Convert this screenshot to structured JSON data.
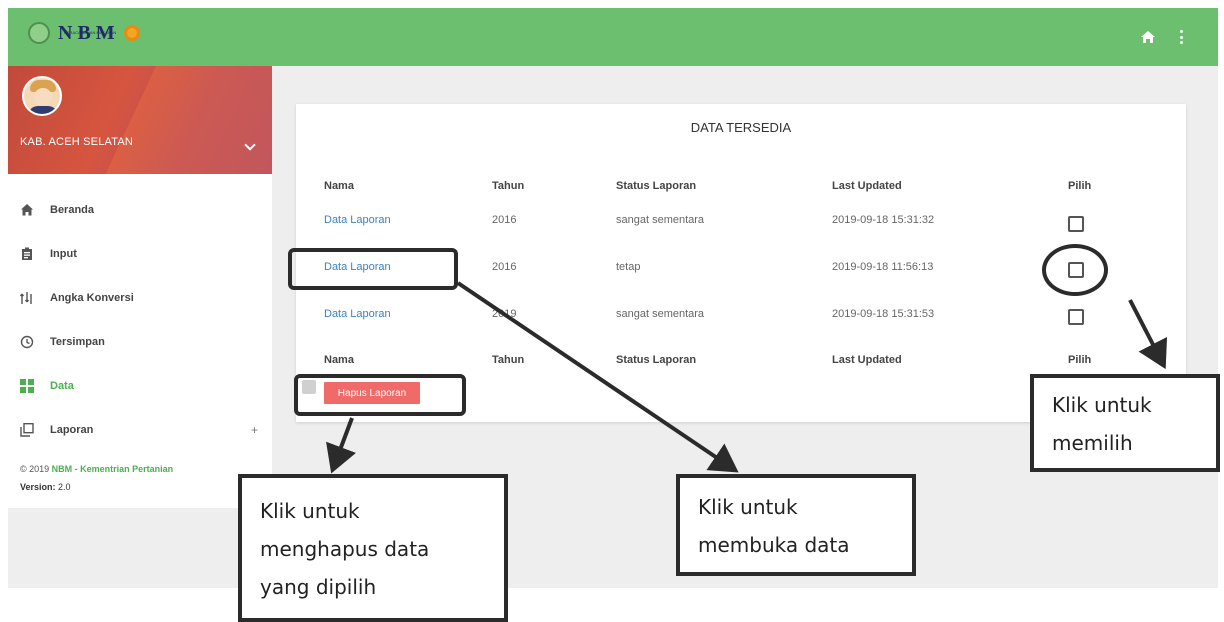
{
  "app": {
    "logo_text": "NBM",
    "logo_subtitle": "NERACA BAHAN MAKANAN"
  },
  "sidebar": {
    "profile_name": "KAB. ACEH SELATAN",
    "items": [
      {
        "label": "Beranda",
        "icon": "home-icon",
        "active": false
      },
      {
        "label": "Input",
        "icon": "clipboard-icon",
        "active": false
      },
      {
        "label": "Angka Konversi",
        "icon": "compare-icon",
        "active": false
      },
      {
        "label": "Tersimpan",
        "icon": "history-icon",
        "active": false
      },
      {
        "label": "Data",
        "icon": "grid-icon",
        "active": true
      },
      {
        "label": "Laporan",
        "icon": "copy-icon",
        "active": false,
        "expand": "+"
      }
    ],
    "footer_copy_prefix": "© 2019 ",
    "footer_copy_link": "NBM - Kementrian Pertanian",
    "footer_version_label": "Version:",
    "footer_version_value": " 2.0"
  },
  "card": {
    "title": "DATA TERSEDIA",
    "columns": [
      "Nama",
      "Tahun",
      "Status Laporan",
      "Last Updated",
      "Pilih"
    ],
    "rows": [
      {
        "nama": "Data Laporan",
        "tahun": "2016",
        "status": "sangat sementara",
        "updated": "2019-09-18 15:31:32",
        "checked": false
      },
      {
        "nama": "Data Laporan",
        "tahun": "2016",
        "status": "tetap",
        "updated": "2019-09-18 11:56:13",
        "checked": false
      },
      {
        "nama": "Data Laporan",
        "tahun": "2019",
        "status": "sangat sementara",
        "updated": "2019-09-18 15:31:53",
        "checked": false
      }
    ],
    "delete_button": "Hapus Laporan"
  },
  "annotations": {
    "select": [
      "Klik untuk",
      "memilih"
    ],
    "open": [
      "Klik untuk",
      "membuka data"
    ],
    "delete": [
      "Klik untuk",
      "menghapus data",
      "yang dipilih"
    ]
  },
  "colors": {
    "topbar": "#6cbf6e",
    "active_nav": "#4caf50",
    "link": "#3b82c4",
    "delete_button": "#f06a6a"
  }
}
